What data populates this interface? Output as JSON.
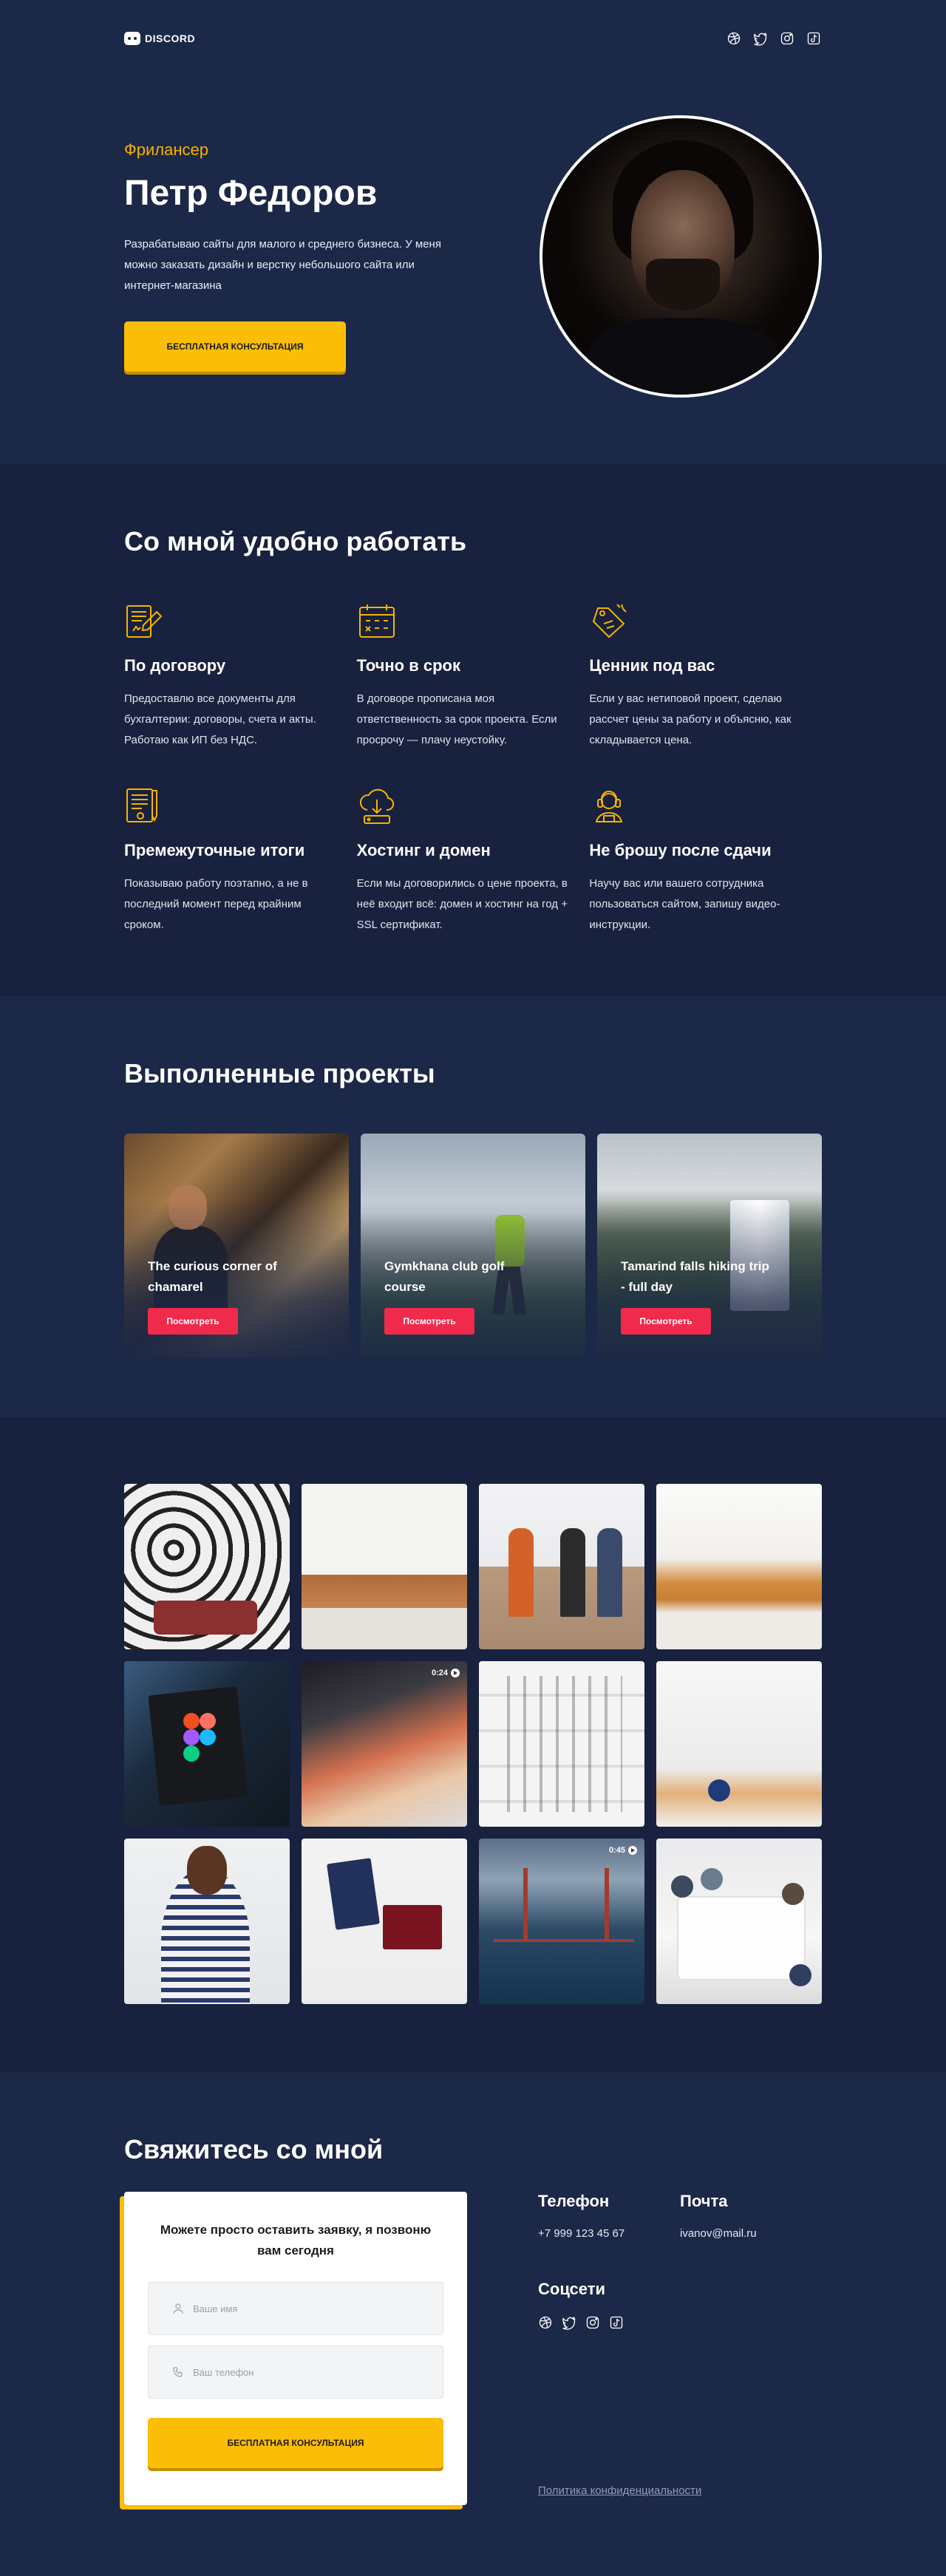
{
  "brand": {
    "logo_text": "DISCORD"
  },
  "header": {
    "socials": [
      {
        "icon": "dribbble-icon"
      },
      {
        "icon": "twitter-icon"
      },
      {
        "icon": "instagram-icon"
      },
      {
        "icon": "tiktok-icon"
      }
    ]
  },
  "hero": {
    "subtitle": "Фрилансер",
    "name": "Петр Федоров",
    "description": "Разрабатываю сайты для малого и среднего бизнеса. У меня можно заказать дизайн и верстку небольшого сайта или интернет-магазина",
    "cta": "Бесплатная консультация"
  },
  "features": {
    "title": "Со мной удобно работать",
    "items": [
      {
        "icon": "contract-icon",
        "title": "По договору",
        "text": "Предоставлю все документы для бухгалтерии: договоры, счета и акты. Работаю как ИП без НДС."
      },
      {
        "icon": "calendar-icon",
        "title": "Точно в срок",
        "text": "В договоре прописана моя ответственность за срок проекта. Если просрочу — плачу неустойку."
      },
      {
        "icon": "price-tag-icon",
        "title": "Ценник под вас",
        "text": "Если у вас нетиповой проект, сделаю рассчет цены за работу и объясню, как складывается цена."
      },
      {
        "icon": "document-pen-icon",
        "title": "Премежуточные итоги",
        "text": "Показываю работу поэтапно, а не в последний момент перед крайним сроком."
      },
      {
        "icon": "cloud-hosting-icon",
        "title": "Хостинг и домен",
        "text": "Если мы договорились о цене проекта, в неё входит всё: домен и хостинг на год + SSL сертификат."
      },
      {
        "icon": "support-icon",
        "title": "Не брошу после сдачи",
        "text": "Научу вас или вашего сотрудника пользоваться сайтом, запишу видео-инструкции."
      }
    ]
  },
  "projects": {
    "title": "Выполненные проекты",
    "button_label": "Посмотреть",
    "items": [
      {
        "title": "The curious corner of chamarel"
      },
      {
        "title": "Gymkhana club golf course"
      },
      {
        "title": "Tamarind falls hiking trip - full day"
      }
    ]
  },
  "gallery": {
    "video_badges": {
      "item6": "0:24",
      "item11": "0:45"
    }
  },
  "contact": {
    "title": "Свяжитесь со мной",
    "form_title": "Можете просто оставить заявку, я позвоню вам сегодня",
    "name_placeholder": "Ваше имя",
    "phone_placeholder": "Ваш телефон",
    "submit": "Бесплатная консультация",
    "phone_label": "Телефон",
    "phone_value": "+7 999 123 45 67",
    "mail_label": "Почта",
    "mail_value": "ivanov@mail.ru",
    "socials_label": "Соцсети",
    "policy": "Политика конфиденциальности"
  },
  "colors": {
    "accent_yellow": "#fbbd06",
    "accent_red": "#ef2a4b",
    "bg_dark": "#1c2847",
    "bg_darker": "#18213d"
  }
}
